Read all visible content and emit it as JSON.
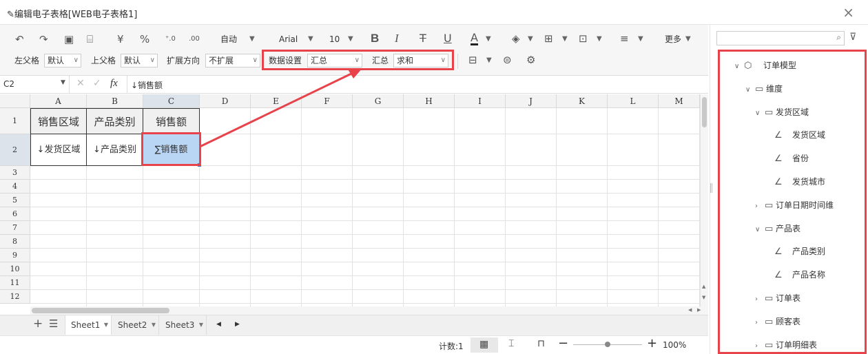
{
  "window": {
    "title": "编辑电子表格[WEB电子表格1]"
  },
  "toolbar": {
    "auto_label": "自动",
    "font": "Arial",
    "font_size": "10",
    "more": "更多",
    "currency": "¥",
    "percent": "%",
    "inc_dec": "⁺.0",
    "dec_dec": ".00",
    "left_parent_label": "左父格",
    "left_parent_value": "默认",
    "top_parent_label": "上父格",
    "top_parent_value": "默认",
    "expand_dir_label": "扩展方向",
    "expand_dir_value": "不扩展",
    "data_setting_label": "数据设置",
    "data_setting_value": "汇总",
    "summary_label": "汇总",
    "summary_value": "求和"
  },
  "formula_bar": {
    "cell_ref": "C2",
    "fx": "fx",
    "content": "↓销售额"
  },
  "grid": {
    "columns": [
      "A",
      "B",
      "C",
      "D",
      "E",
      "F",
      "G",
      "H",
      "I",
      "J",
      "K",
      "L",
      "M"
    ],
    "rows": [
      "1",
      "2",
      "3",
      "4",
      "5",
      "6",
      "7",
      "8",
      "9",
      "10",
      "11",
      "12"
    ],
    "cells": {
      "A1": "销售区域",
      "B1": "产品类别",
      "C1": "销售额",
      "A2": "↓发货区域",
      "B2": "↓产品类别",
      "C2": "∑销售额"
    }
  },
  "sheets": {
    "add": "+",
    "list": "☰",
    "tabs": [
      "Sheet1",
      "Sheet2",
      "Sheet3"
    ]
  },
  "status": {
    "count": "计数:1",
    "zoom": "100%",
    "zoom_level": 1.0
  },
  "tree": [
    {
      "label": "订单模型",
      "level": 0,
      "type": "model",
      "expanded": true
    },
    {
      "label": "维度",
      "level": 1,
      "type": "folder",
      "expanded": true
    },
    {
      "label": "发货区域",
      "level": 2,
      "type": "folder",
      "expanded": true
    },
    {
      "label": "发货区域",
      "level": 3,
      "type": "field"
    },
    {
      "label": "省份",
      "level": 3,
      "type": "field"
    },
    {
      "label": "发货城市",
      "level": 3,
      "type": "field"
    },
    {
      "label": "订单日期时间维",
      "level": 2,
      "type": "folder",
      "expanded": false
    },
    {
      "label": "产品表",
      "level": 2,
      "type": "folder",
      "expanded": true
    },
    {
      "label": "产品类别",
      "level": 3,
      "type": "field"
    },
    {
      "label": "产品名称",
      "level": 3,
      "type": "field"
    },
    {
      "label": "订单表",
      "level": 2,
      "type": "folder",
      "expanded": false
    },
    {
      "label": "顾客表",
      "level": 2,
      "type": "folder",
      "expanded": false
    },
    {
      "label": "订单明细表",
      "level": 2,
      "type": "folder",
      "expanded": false
    }
  ],
  "colors": {
    "highlight": "#e8424a",
    "selected_cell": "#b9d6f5",
    "header_bg": "#f3f3f3"
  }
}
